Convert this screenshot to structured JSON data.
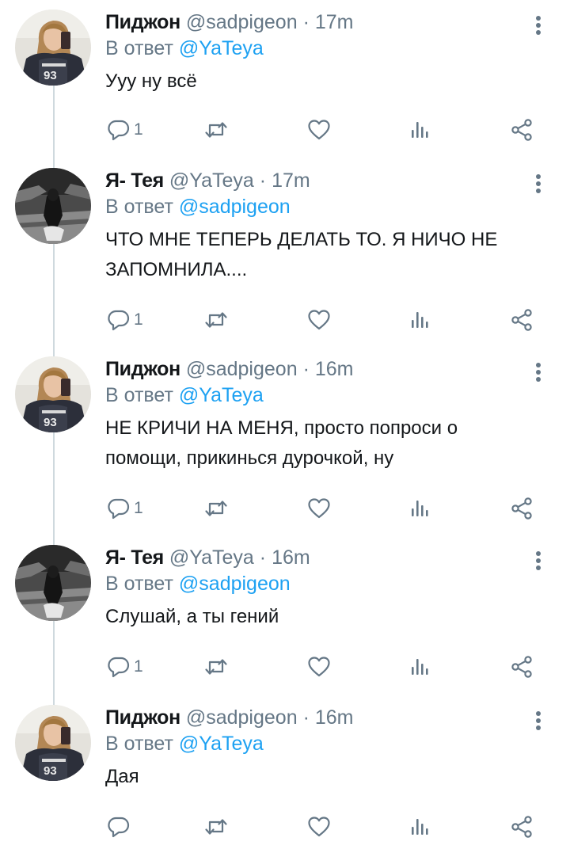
{
  "tweets": [
    {
      "author": "Пиджон",
      "handle": "@sadpigeon",
      "separator": "·",
      "time": "17m",
      "reply_prefix": "В ответ",
      "reply_to": "@YaTeya",
      "text": "Ууу ну всё",
      "reply_count": "1",
      "avatar": "pigeon-avatar"
    },
    {
      "author": "Я- Тея",
      "handle": "@YaTeya",
      "separator": "·",
      "time": "17m",
      "reply_prefix": "В ответ",
      "reply_to": "@sadpigeon",
      "text": "ЧТО МНЕ ТЕПЕРЬ ДЕЛАТЬ ТО. Я НИЧО НЕ ЗАПОМНИЛА....",
      "reply_count": "1",
      "avatar": "teya-avatar"
    },
    {
      "author": "Пиджон",
      "handle": "@sadpigeon",
      "separator": "·",
      "time": "16m",
      "reply_prefix": "В ответ",
      "reply_to": "@YaTeya",
      "text": "НЕ КРИЧИ НА МЕНЯ, просто попроси о помощи, прикинься дурочкой, ну",
      "reply_count": "1",
      "avatar": "pigeon-avatar"
    },
    {
      "author": "Я- Тея",
      "handle": "@YaTeya",
      "separator": "·",
      "time": "16m",
      "reply_prefix": "В ответ",
      "reply_to": "@sadpigeon",
      "text": "Слушай, а ты гений",
      "reply_count": "1",
      "avatar": "teya-avatar"
    },
    {
      "author": "Пиджон",
      "handle": "@sadpigeon",
      "separator": "·",
      "time": "16m",
      "reply_prefix": "В ответ",
      "reply_to": "@YaTeya",
      "text": "Дая",
      "reply_count": "",
      "avatar": "pigeon-avatar"
    }
  ],
  "icons": {
    "reply": "reply-icon",
    "retweet": "retweet-icon",
    "like": "like-icon",
    "analytics": "analytics-icon",
    "share": "share-icon",
    "more": "more-vertical-icon"
  },
  "colors": {
    "text": "#14171a",
    "secondary": "#657786",
    "link": "#1da1f2",
    "thread_line": "#cfd9de",
    "background": "#ffffff"
  }
}
